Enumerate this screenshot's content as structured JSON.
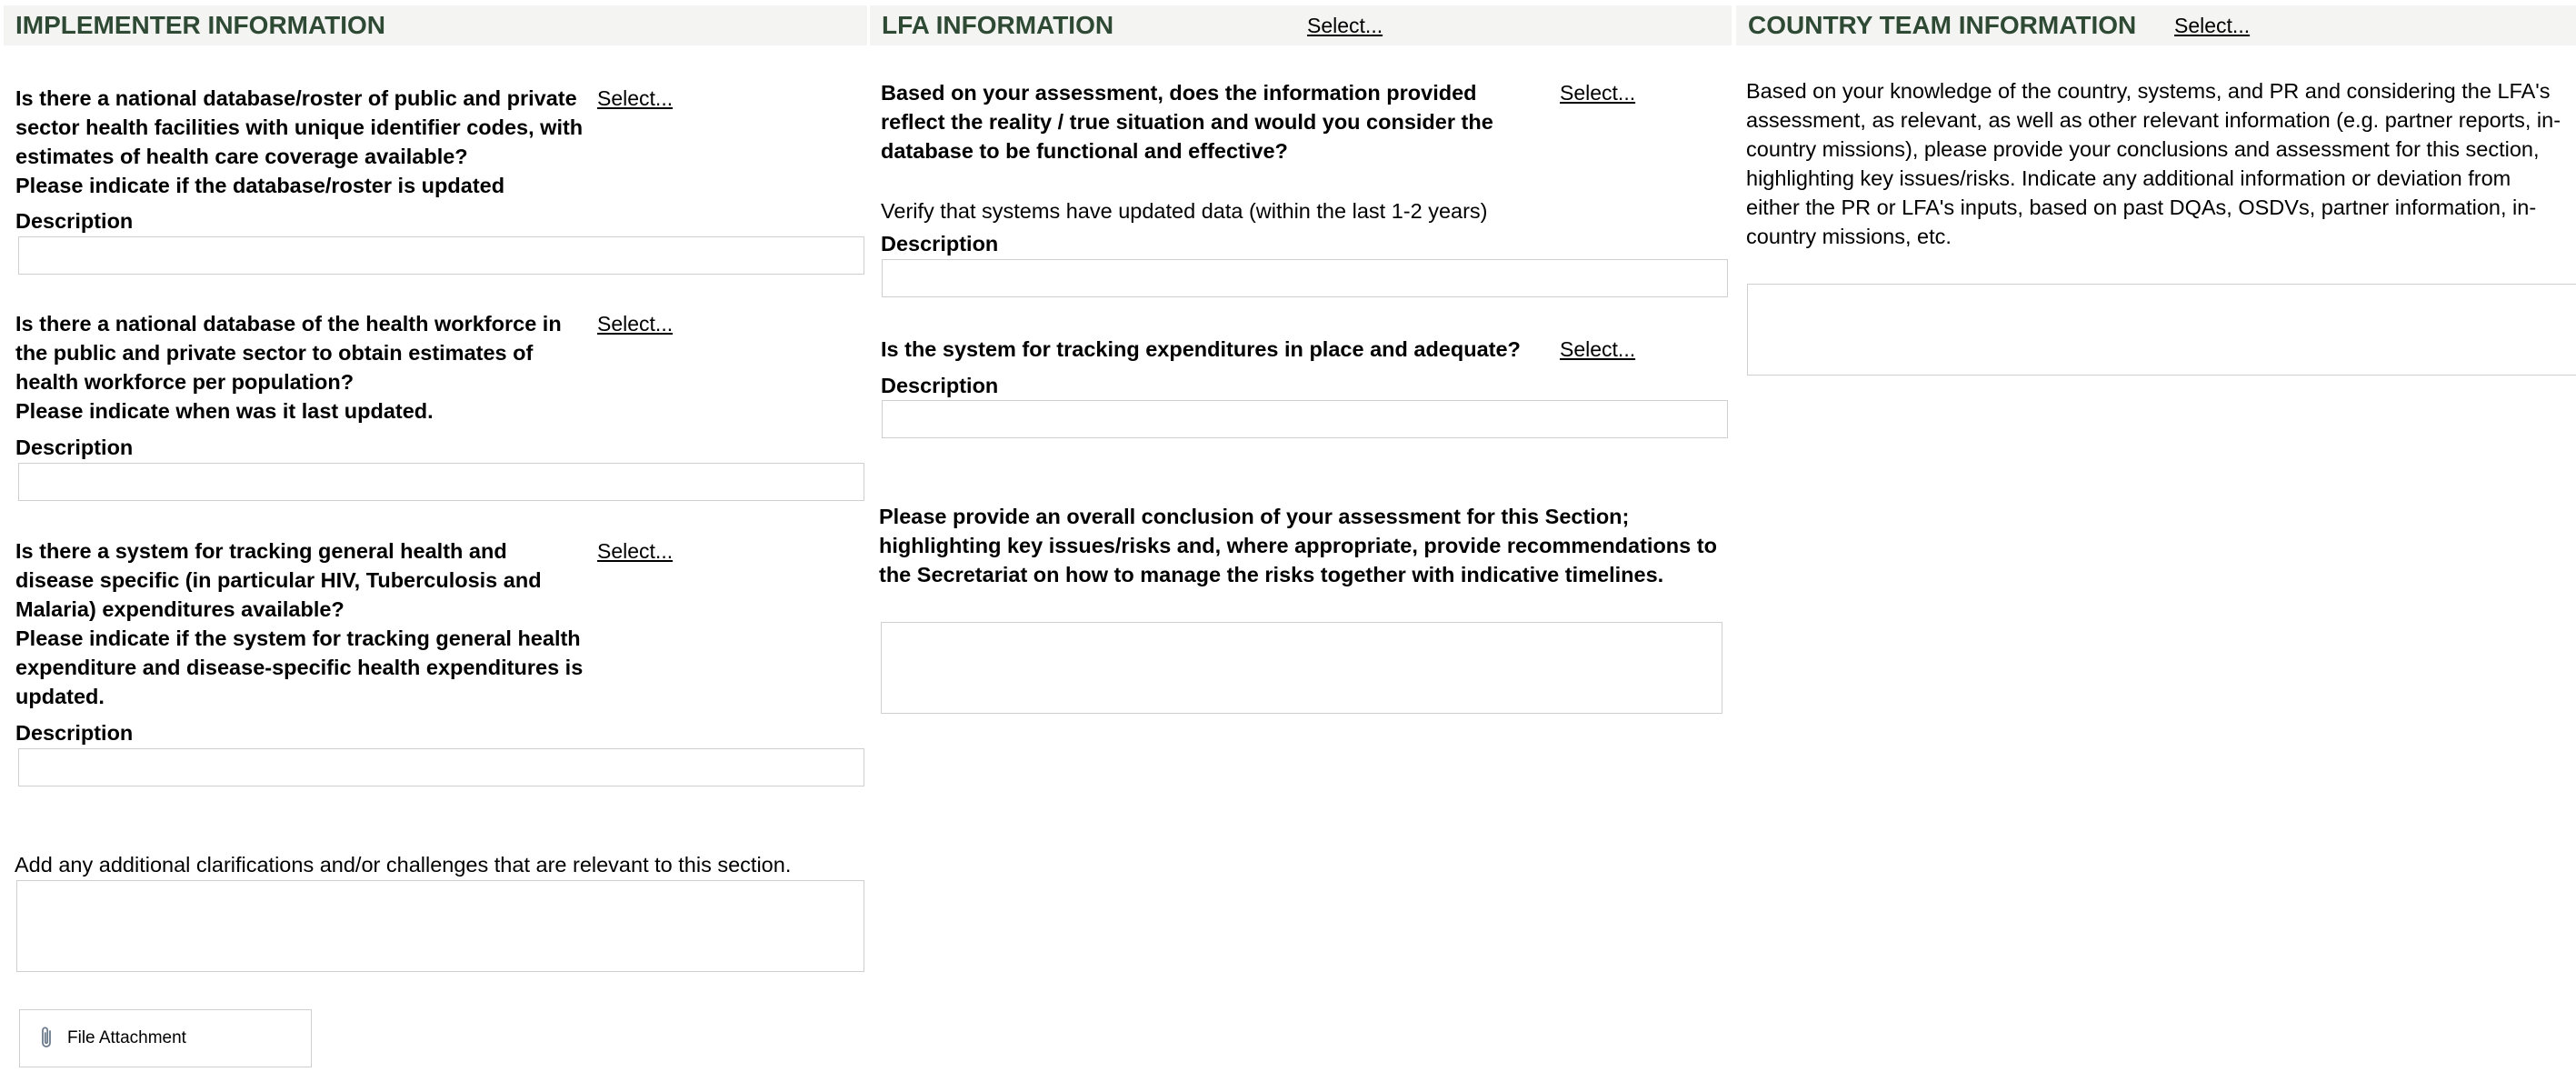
{
  "implementer": {
    "title": "IMPLEMENTER INFORMATION",
    "q1": {
      "question": "Is there a national database/roster of public and private sector health facilities with unique identifier codes, with estimates of health care coverage available?",
      "sub": "Please indicate if the database/roster is updated",
      "select": "Select...",
      "desc_label": "Description",
      "desc_value": ""
    },
    "q2": {
      "question": "Is there a national database of the health workforce in the public and private sector to obtain estimates of health workforce per population?",
      "sub": "Please indicate when was it last updated.",
      "select": "Select...",
      "desc_label": "Description",
      "desc_value": ""
    },
    "q3": {
      "question": "Is there a system for tracking general health and disease specific (in particular HIV, Tuberculosis and Malaria) expenditures available?",
      "sub": "Please indicate if the system for tracking general health expenditure and disease-specific health expenditures is updated.",
      "select": "Select...",
      "desc_label": "Description",
      "desc_value": ""
    },
    "additional_label": "Add any additional clarifications and/or challenges that are relevant to this section.",
    "additional_value": "",
    "file_attachment": "File Attachment"
  },
  "lfa": {
    "title": "LFA INFORMATION",
    "header_select": "Select...",
    "q1": {
      "question": "Based on your assessment, does the information provided reflect the reality / true situation and would you consider the database to be functional and effective?",
      "select": "Select...",
      "verify": "Verify that systems have updated data (within the last 1-2 years)",
      "desc_label": "Description",
      "desc_value": ""
    },
    "q2": {
      "question": "Is the system for tracking expenditures in place and adequate?",
      "select": "Select...",
      "desc_label": "Description",
      "desc_value": ""
    },
    "conclusion_label": "Please provide an overall conclusion of your assessment for this Section; highlighting key issues/risks and, where appropriate, provide recommendations to the Secretariat on how to manage the risks together with indicative timelines.",
    "conclusion_value": ""
  },
  "country_team": {
    "title": "COUNTRY TEAM INFORMATION",
    "header_select": "Select...",
    "text": "Based on your knowledge of the country, systems, and PR and considering the LFA's assessment, as relevant, as well as other relevant information (e.g. partner reports, in-country missions), please provide your conclusions and assessment for this section, highlighting key issues/risks. Indicate any additional information or deviation from either the PR or LFA's inputs, based on past DQAs, OSDVs, partner information, in-country missions, etc.",
    "value": ""
  }
}
